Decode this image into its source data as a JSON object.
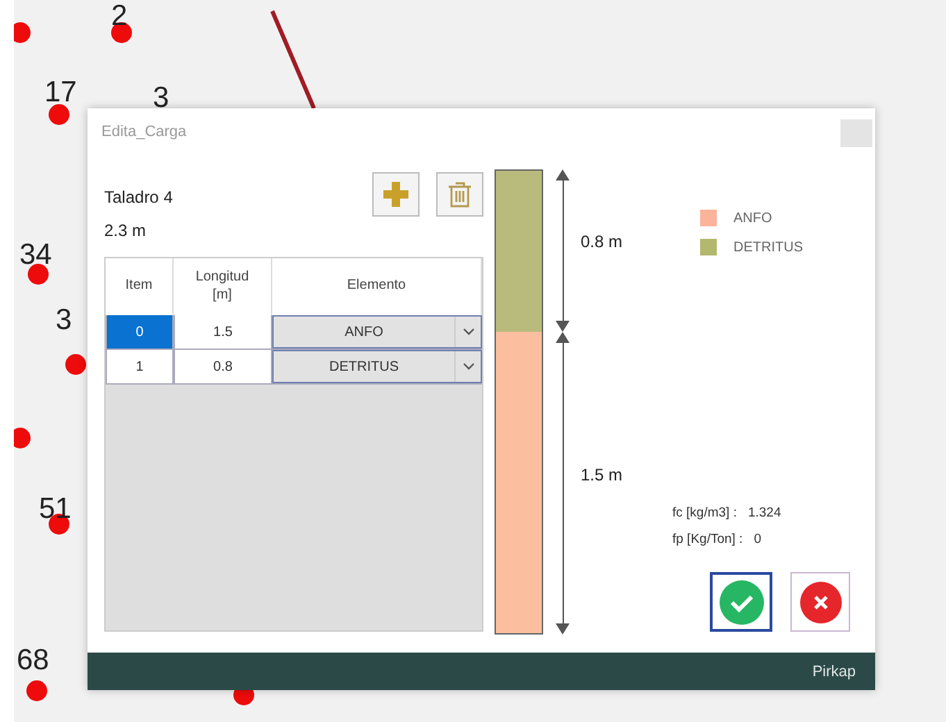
{
  "map": {
    "points": [
      {
        "label": "2"
      },
      {
        "label": "17"
      },
      {
        "label": "3"
      },
      {
        "label": "34"
      },
      {
        "label": "3"
      },
      {
        "label": "51"
      },
      {
        "label": "68"
      }
    ]
  },
  "dialog": {
    "title": "Edita_Carga",
    "hole_name": "Taladro 4",
    "hole_length": "2.3 m",
    "table": {
      "columns": [
        "Item",
        "Longitud\n[m]",
        "Elemento"
      ],
      "rows": [
        {
          "item": "0",
          "length": "1.5",
          "element": "ANFO",
          "selected": true
        },
        {
          "item": "1",
          "length": "0.8",
          "element": "DETRITUS",
          "selected": false
        }
      ]
    },
    "column": {
      "segments": [
        {
          "label": "0.8 m",
          "color": "#b8bb7c"
        },
        {
          "label": "1.5 m",
          "color": "#fbbfa0"
        }
      ]
    },
    "legend": [
      {
        "label": "ANFO",
        "color": "#fbb49a"
      },
      {
        "label": "DETRITUS",
        "color": "#b2b86e"
      }
    ],
    "stats": [
      {
        "label": "fc [kg/m3] :",
        "value": "1.324"
      },
      {
        "label": "fp [Kg/Ton] :",
        "value": "0"
      }
    ],
    "footer": "Pirkap"
  }
}
